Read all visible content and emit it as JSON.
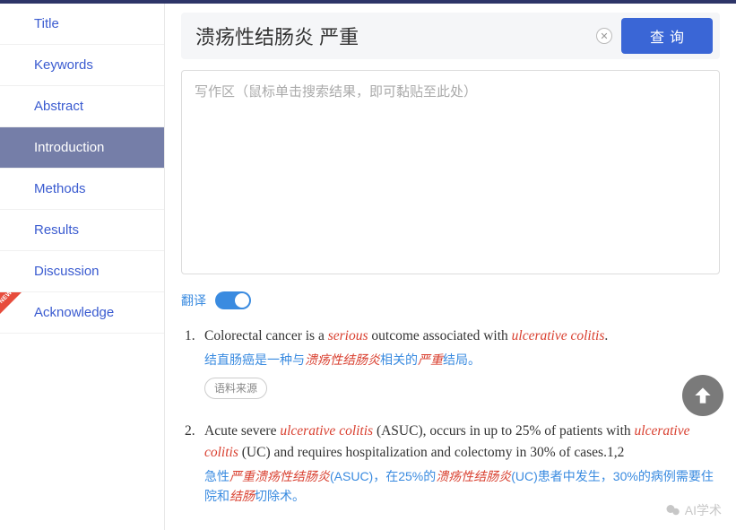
{
  "sidebar": {
    "items": [
      {
        "label": "Title",
        "active": false
      },
      {
        "label": "Keywords",
        "active": false
      },
      {
        "label": "Abstract",
        "active": false
      },
      {
        "label": "Introduction",
        "active": true
      },
      {
        "label": "Methods",
        "active": false
      },
      {
        "label": "Results",
        "active": false
      },
      {
        "label": "Discussion",
        "active": false
      },
      {
        "label": "Acknowledge",
        "active": false,
        "new": true
      }
    ]
  },
  "search": {
    "value": "溃疡性结肠炎 严重",
    "query_label": "查询"
  },
  "writearea": {
    "placeholder": "写作区（鼠标单击搜索结果，即可黏贴至此处）"
  },
  "translate": {
    "label": "翻译",
    "on": true
  },
  "results": [
    {
      "num": "1.",
      "en_parts": [
        "Colorectal cancer is a ",
        {
          "hl": "serious"
        },
        " outcome associated with ",
        {
          "hl": "ulcerative colitis"
        },
        "."
      ],
      "cn_parts": [
        "结直肠癌是一种与",
        {
          "hl": "溃疡性结肠炎"
        },
        "相关的",
        {
          "hl": "严重"
        },
        "结局。"
      ],
      "source_label": "语料来源"
    },
    {
      "num": "2.",
      "en_parts": [
        "Acute severe ",
        {
          "hl": "ulcerative colitis"
        },
        " (ASUC), occurs in up to 25% of patients with ",
        {
          "hl": "ulcerative colitis"
        },
        " (UC) and requires hospitalization and colectomy in 30% of cases.1,2"
      ],
      "cn_parts": [
        "急性",
        {
          "hl": "严重溃疡性结肠炎"
        },
        "(ASUC)，在25%的",
        {
          "hl": "溃疡性结肠炎"
        },
        "(UC)患者中发生，30%的病例需要住院和",
        {
          "hl": "结肠"
        },
        "切除术。"
      ]
    }
  ],
  "watermark": {
    "text": "AI学术"
  }
}
